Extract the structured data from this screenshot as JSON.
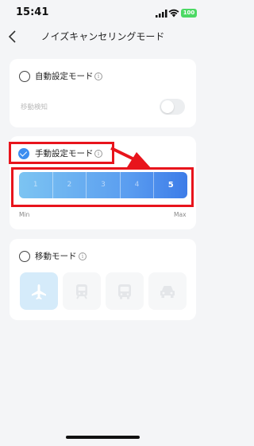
{
  "status_bar": {
    "time": "15:41",
    "battery": "100",
    "battery_color": "#4cd964"
  },
  "nav": {
    "title": "ノイズキャンセリングモード",
    "back_icon": "chevron-left-icon"
  },
  "auto_mode": {
    "label": "自動設定モード",
    "selected": false,
    "info_icon": "i",
    "sub_label": "移動検知",
    "toggle_on": false
  },
  "manual_mode": {
    "label": "手動設定モード",
    "selected": true,
    "info_icon": "i",
    "levels": [
      "1",
      "2",
      "3",
      "4",
      "5"
    ],
    "selected_level": "5",
    "min_label": "Min",
    "max_label": "Max"
  },
  "move_mode": {
    "label": "移動モード",
    "selected": false,
    "info_icon": "i",
    "tiles": [
      {
        "icon": "airplane-icon",
        "active": true
      },
      {
        "icon": "train-icon",
        "active": false
      },
      {
        "icon": "bus-icon",
        "active": false
      },
      {
        "icon": "car-icon",
        "active": false
      }
    ]
  },
  "colors": {
    "accent": "#3d8ef0",
    "annotation_red": "#e8141c",
    "active_tile": "#d5ebfa"
  }
}
